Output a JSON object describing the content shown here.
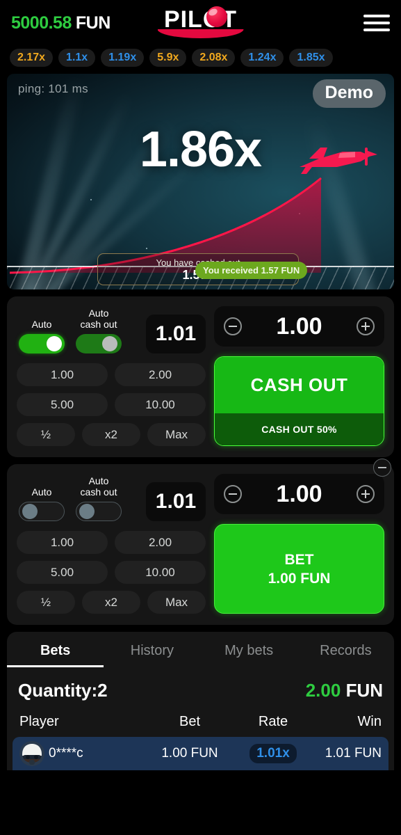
{
  "header": {
    "balance_amount": "5000.58",
    "currency": "FUN",
    "logo_text": "PILOT",
    "menu_label": "menu"
  },
  "history_chips": [
    {
      "label": "2.17x",
      "tone": "hi"
    },
    {
      "label": "1.1x",
      "tone": "lo"
    },
    {
      "label": "1.19x",
      "tone": "lo"
    },
    {
      "label": "5.9x",
      "tone": "hi"
    },
    {
      "label": "2.08x",
      "tone": "hi"
    },
    {
      "label": "1.24x",
      "tone": "lo"
    },
    {
      "label": "1.85x",
      "tone": "lo"
    }
  ],
  "game": {
    "ping": "ping: 101 ms",
    "demo_badge": "Demo",
    "multiplier": "1.86x",
    "cashed_out_title": "You have cashed out",
    "cashed_out_value": "1.57x",
    "received_toast": "You received 1.57 FUN"
  },
  "panel1": {
    "auto_label": "Auto",
    "auto_cashout_label": "Auto\ncash out",
    "auto_cashout_value": "1.01",
    "stake_value": "1.00",
    "quick_amounts": [
      "1.00",
      "2.00",
      "5.00",
      "10.00"
    ],
    "modifiers": [
      "½",
      "x2",
      "Max"
    ],
    "action_main": "CASH OUT",
    "action_sub": "CASH OUT 50%",
    "minus_label": "−",
    "plus_label": "+"
  },
  "panel2": {
    "auto_label": "Auto",
    "auto_cashout_label": "Auto\ncash out",
    "auto_cashout_value": "1.01",
    "stake_value": "1.00",
    "quick_amounts": [
      "1.00",
      "2.00",
      "5.00",
      "10.00"
    ],
    "modifiers": [
      "½",
      "x2",
      "Max"
    ],
    "action_main": "BET",
    "action_amount": "1.00 FUN",
    "minus_label": "−",
    "plus_label": "+"
  },
  "bottom": {
    "tabs": [
      "Bets",
      "History",
      "My bets",
      "Records"
    ],
    "active_tab": "Bets",
    "quantity_label": "Quantity:",
    "quantity_value": "2",
    "total_amount": "2.00",
    "total_currency": "FUN",
    "columns": [
      "Player",
      "Bet",
      "Rate",
      "Win"
    ],
    "rows": [
      {
        "player": "0****c",
        "bet": "1.00 FUN",
        "rate": "1.01x",
        "win": "1.01 FUN"
      }
    ]
  },
  "colors": {
    "green": "#2ecc40",
    "orange": "#f0a81e",
    "blue": "#2f8fe8",
    "crimson": "#e4093f"
  }
}
